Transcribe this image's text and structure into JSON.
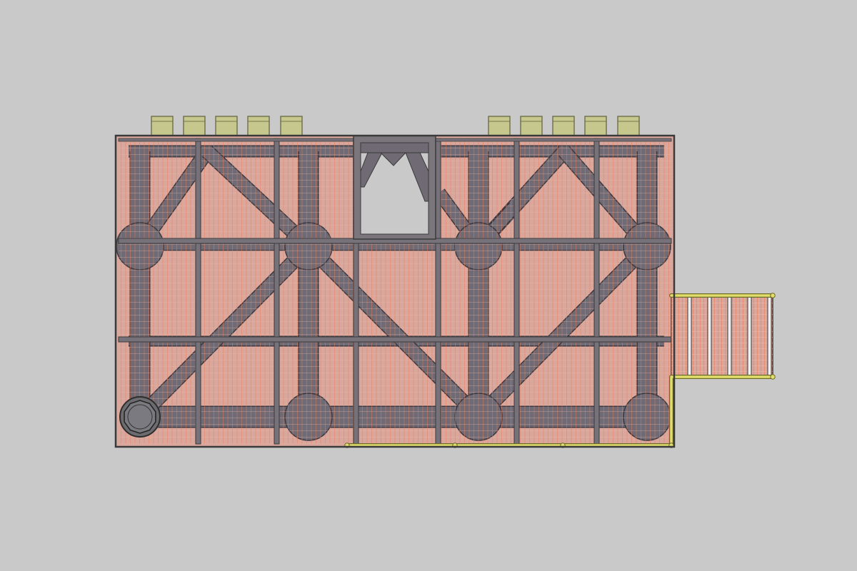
{
  "drawing": {
    "view": "top",
    "colors": {
      "background": "#c9c9c9",
      "frame_outline": "#3a3a3a",
      "member_fill": "#6f6a73",
      "member_stroke": "#3c3940",
      "deck_fill": "#d9a79c",
      "grating_line": "#ef7a57",
      "grating_line_light": "#f2b8a6",
      "handrail": "#e2de6c",
      "handrail_stroke": "#6d6a2a",
      "boat_landing_bumper": "#c6c78c",
      "bumper_stroke": "#5e5f3a",
      "opening_fill": "#c9c9c9",
      "caisson_fill": "#6c6b6f"
    },
    "components": [
      "deck-frame",
      "grating-panels",
      "horizontal-bracing",
      "leg-nodes",
      "caisson",
      "boat-landing-bumpers",
      "walkway",
      "handrail"
    ]
  }
}
